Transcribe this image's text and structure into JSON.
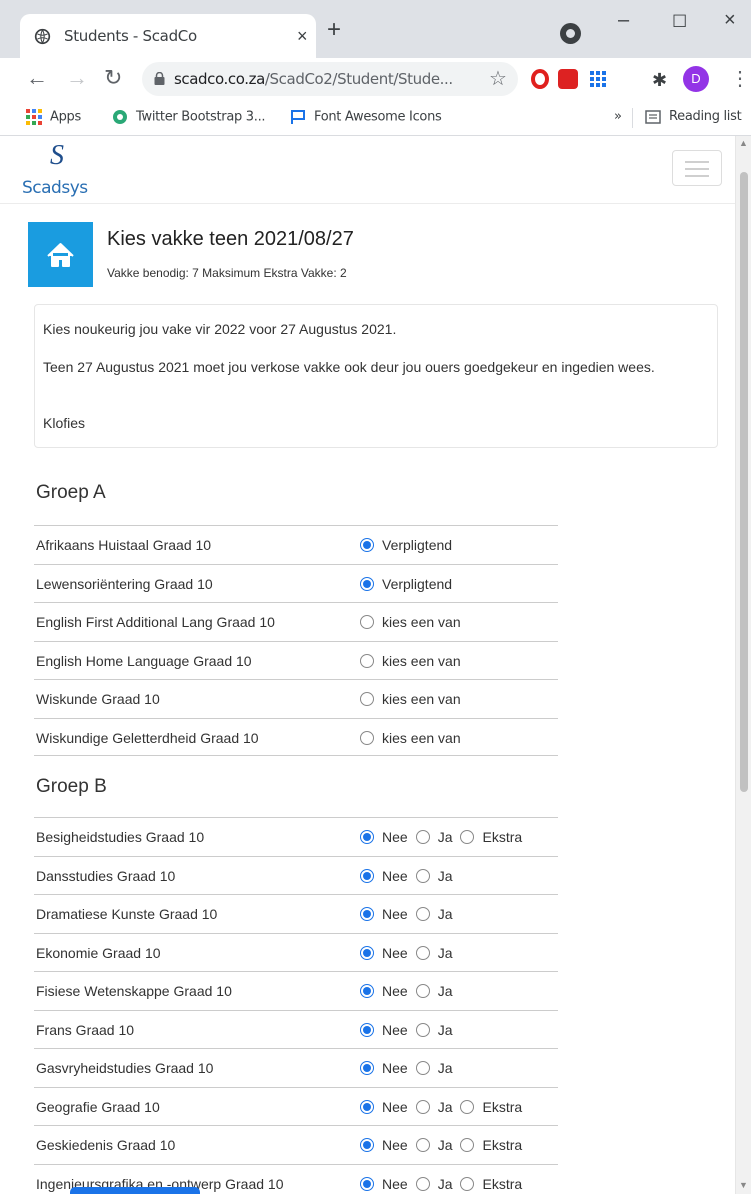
{
  "browser": {
    "tab_title": "Students - ScadCo",
    "tab_close": "×",
    "new_tab": "+",
    "url_domain": "scadco.co.za",
    "url_path": "/ScadCo2/Student/Stude...",
    "avatar_letter": "D",
    "window_minimize": "–",
    "window_maximize": "☐",
    "window_close": "×"
  },
  "bookmarks": {
    "apps": "Apps",
    "item1": "Twitter Bootstrap 3...",
    "item2": "Font Awesome Icons",
    "more": "»",
    "reading_list": "Reading list"
  },
  "site": {
    "logo_text": "Scadsys"
  },
  "header": {
    "title": "Kies vakke teen 2021/08/27",
    "subtitle": "Vakke benodig: 7 Maksimum Ekstra Vakke: 2"
  },
  "note": {
    "line1": "Kies noukeurig jou vake vir 2022 voor 27 Augustus 2021.",
    "line2": "Teen 27 Augustus 2021 moet jou verkose vakke ook deur jou ouers goedgekeur en ingedien wees.",
    "line3": "Klofies"
  },
  "groepA": {
    "title": "Groep A",
    "rows": [
      {
        "subject": "Afrikaans Huistaal Graad 10",
        "option": "Verpligtend",
        "selected": true
      },
      {
        "subject": "Lewensoriëntering Graad 10",
        "option": "Verpligtend",
        "selected": true
      },
      {
        "subject": "English First Additional Lang Graad 10",
        "option": "kies een van",
        "selected": false
      },
      {
        "subject": "English Home Language Graad 10",
        "option": "kies een van",
        "selected": false
      },
      {
        "subject": "Wiskunde Graad 10",
        "option": "kies een van",
        "selected": false
      },
      {
        "subject": "Wiskundige Geletterdheid Graad 10",
        "option": "kies een van",
        "selected": false
      }
    ]
  },
  "groepB": {
    "title": "Groep B",
    "labels": {
      "nee": "Nee",
      "ja": "Ja",
      "ekstra": "Ekstra"
    },
    "rows": [
      {
        "subject": "Besigheidstudies Graad 10",
        "selected": "Nee",
        "ekstra": true
      },
      {
        "subject": "Dansstudies Graad 10",
        "selected": "Nee",
        "ekstra": false
      },
      {
        "subject": "Dramatiese Kunste Graad 10",
        "selected": "Nee",
        "ekstra": false
      },
      {
        "subject": "Ekonomie Graad 10",
        "selected": "Nee",
        "ekstra": false
      },
      {
        "subject": "Fisiese Wetenskappe Graad 10",
        "selected": "Nee",
        "ekstra": false
      },
      {
        "subject": "Frans Graad 10",
        "selected": "Nee",
        "ekstra": false
      },
      {
        "subject": "Gasvryheidstudies Graad 10",
        "selected": "Nee",
        "ekstra": false
      },
      {
        "subject": "Geografie Graad 10",
        "selected": "Nee",
        "ekstra": true
      },
      {
        "subject": "Geskiedenis Graad 10",
        "selected": "Nee",
        "ekstra": true
      },
      {
        "subject": "Ingenieursgrafika en -ontwerp Graad 10",
        "selected": "Nee",
        "ekstra": true
      }
    ]
  },
  "colors": {
    "accent": "#1a9ce0",
    "radio": "#1a73e8",
    "avatar": "#9334e6"
  }
}
